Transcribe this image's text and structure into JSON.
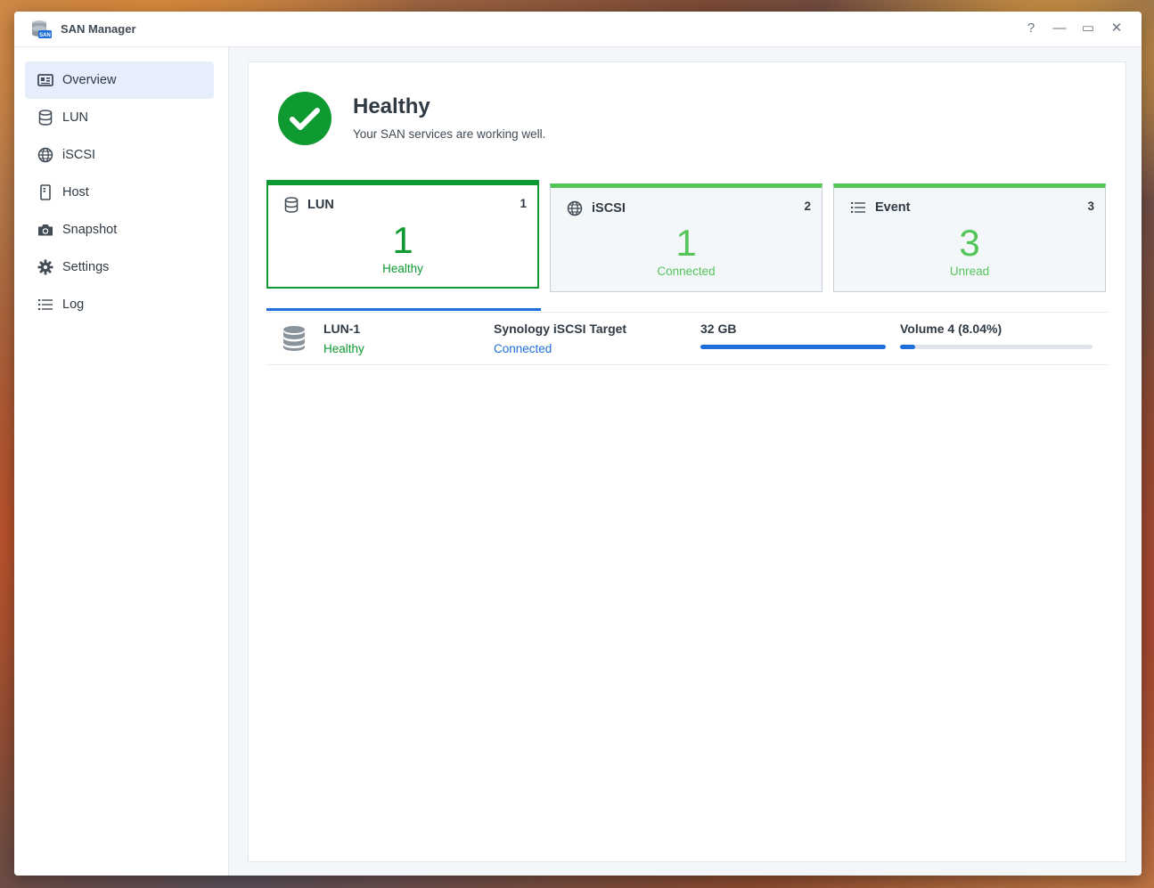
{
  "window": {
    "title": "SAN Manager",
    "app_icon_badge": "SAN",
    "controls": {
      "help": "?",
      "minimize": "—",
      "maximize": "▭",
      "close": "✕"
    }
  },
  "sidebar": {
    "items": [
      {
        "label": "Overview",
        "icon": "overview-icon",
        "active": true
      },
      {
        "label": "LUN",
        "icon": "database-icon",
        "active": false
      },
      {
        "label": "iSCSI",
        "icon": "globe-icon",
        "active": false
      },
      {
        "label": "Host",
        "icon": "host-icon",
        "active": false
      },
      {
        "label": "Snapshot",
        "icon": "camera-icon",
        "active": false
      },
      {
        "label": "Settings",
        "icon": "gear-icon",
        "active": false
      },
      {
        "label": "Log",
        "icon": "list-icon",
        "active": false
      }
    ]
  },
  "status": {
    "title": "Healthy",
    "description": "Your SAN services are working well.",
    "icon": "check-circle-icon"
  },
  "cards": [
    {
      "label": "LUN",
      "count": "1",
      "value": "1",
      "sub": "Healthy",
      "icon": "database-icon",
      "selected": true
    },
    {
      "label": "iSCSI",
      "count": "2",
      "value": "1",
      "sub": "Connected",
      "icon": "globe-icon",
      "selected": false
    },
    {
      "label": "Event",
      "count": "3",
      "value": "3",
      "sub": "Unread",
      "icon": "list-icon",
      "selected": false
    }
  ],
  "lun_list": [
    {
      "name": "LUN-1",
      "status": "Healthy",
      "target": "Synology iSCSI Target",
      "target_status": "Connected",
      "size": "32 GB",
      "size_usage_fraction": 1.0,
      "volume": "Volume 4 (8.04%)",
      "volume_usage_fraction": 0.0804
    }
  ],
  "colors": {
    "accent_blue": "#1e6fd9",
    "healthy_green": "#0e9931",
    "light_green": "#55c55a",
    "active_nav_bg": "#e6eefb"
  }
}
